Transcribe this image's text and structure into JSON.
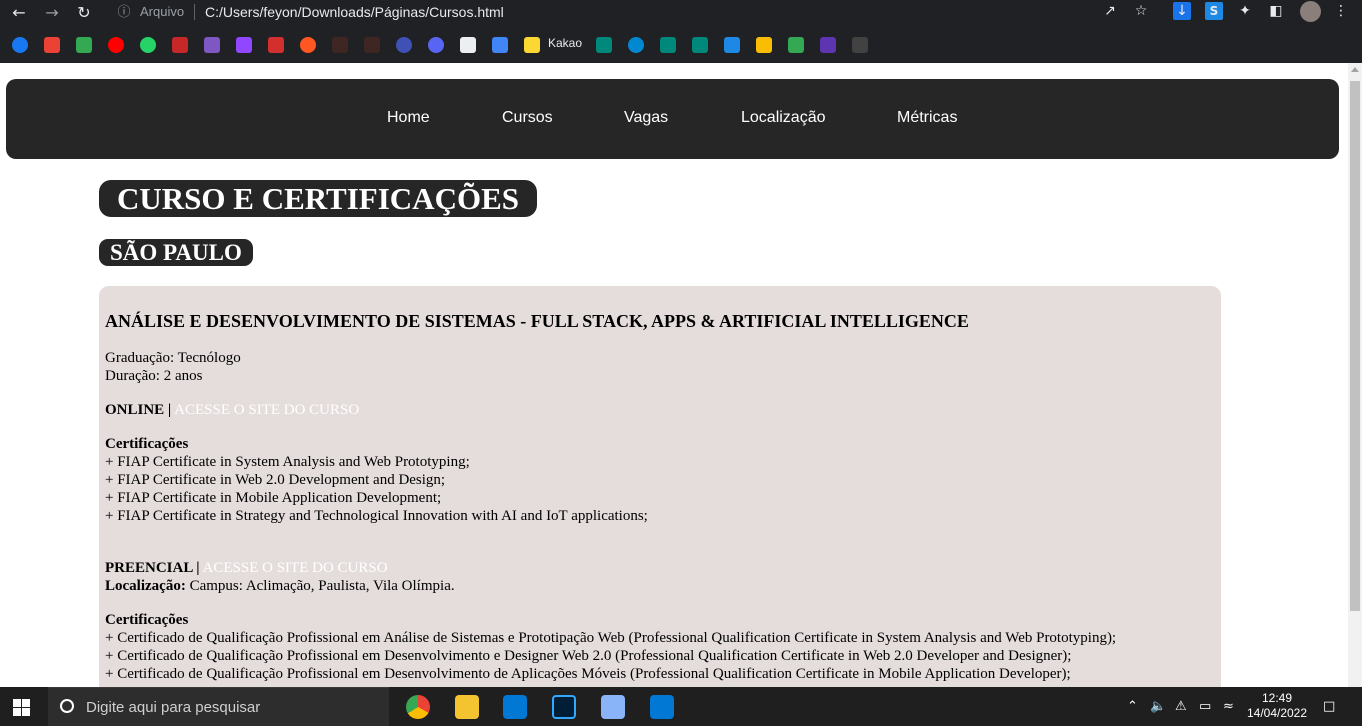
{
  "browser": {
    "address_info": "Arquivo",
    "url": "C:/Users/feyon/Downloads/Páginas/Cursos.html",
    "bookmark_label": "Kakao"
  },
  "nav": {
    "items": [
      "Home",
      "Cursos",
      "Vagas",
      "Localização",
      "Métricas"
    ]
  },
  "page": {
    "title": "CURSO E CERTIFICAÇÕES",
    "city": "SÃO PAULO"
  },
  "course": {
    "name": "ANÁLISE E DESENVOLVIMENTO DE SISTEMAS - FULL STACK, APPS & ARTIFICIAL INTELLIGENCE",
    "graduation": "Graduação: Tecnólogo",
    "duration": "Duração: 2 anos",
    "online": {
      "label": "ONLINE |",
      "link": "ACESSE O SITE DO CURSO",
      "cert_heading": "Certificações",
      "certs": [
        "+ FIAP Certificate in System Analysis and Web Prototyping;",
        "+ FIAP Certificate in Web 2.0 Development and Design;",
        "+ FIAP Certificate in Mobile Application Development;",
        "+ FIAP Certificate in Strategy and Technological Innovation with AI and IoT applications;"
      ]
    },
    "presencial": {
      "label": "PREENCIAL |",
      "link": "ACESSE O SITE DO CURSO",
      "location_label": "Localização:",
      "location_value": "Campus: Aclimação, Paulista, Vila Olímpia.",
      "cert_heading": "Certificações",
      "certs": [
        "+ Certificado de Qualificação Profissional em Análise de Sistemas e Prototipação Web (Professional Qualification Certificate in System Analysis and Web Prototyping);",
        "+ Certificado de Qualificação Profissional em Desenvolvimento e Designer Web 2.0 (Professional Qualification Certificate in Web 2.0 Developer and Designer);",
        "+ Certificado de Qualificação Profissional em Desenvolvimento de Aplicações Móveis (Professional Qualification Certificate in Mobile Application Developer);"
      ]
    }
  },
  "taskbar": {
    "search_placeholder": "Digite aqui para pesquisar",
    "time": "12:49",
    "date": "14/04/2022"
  }
}
